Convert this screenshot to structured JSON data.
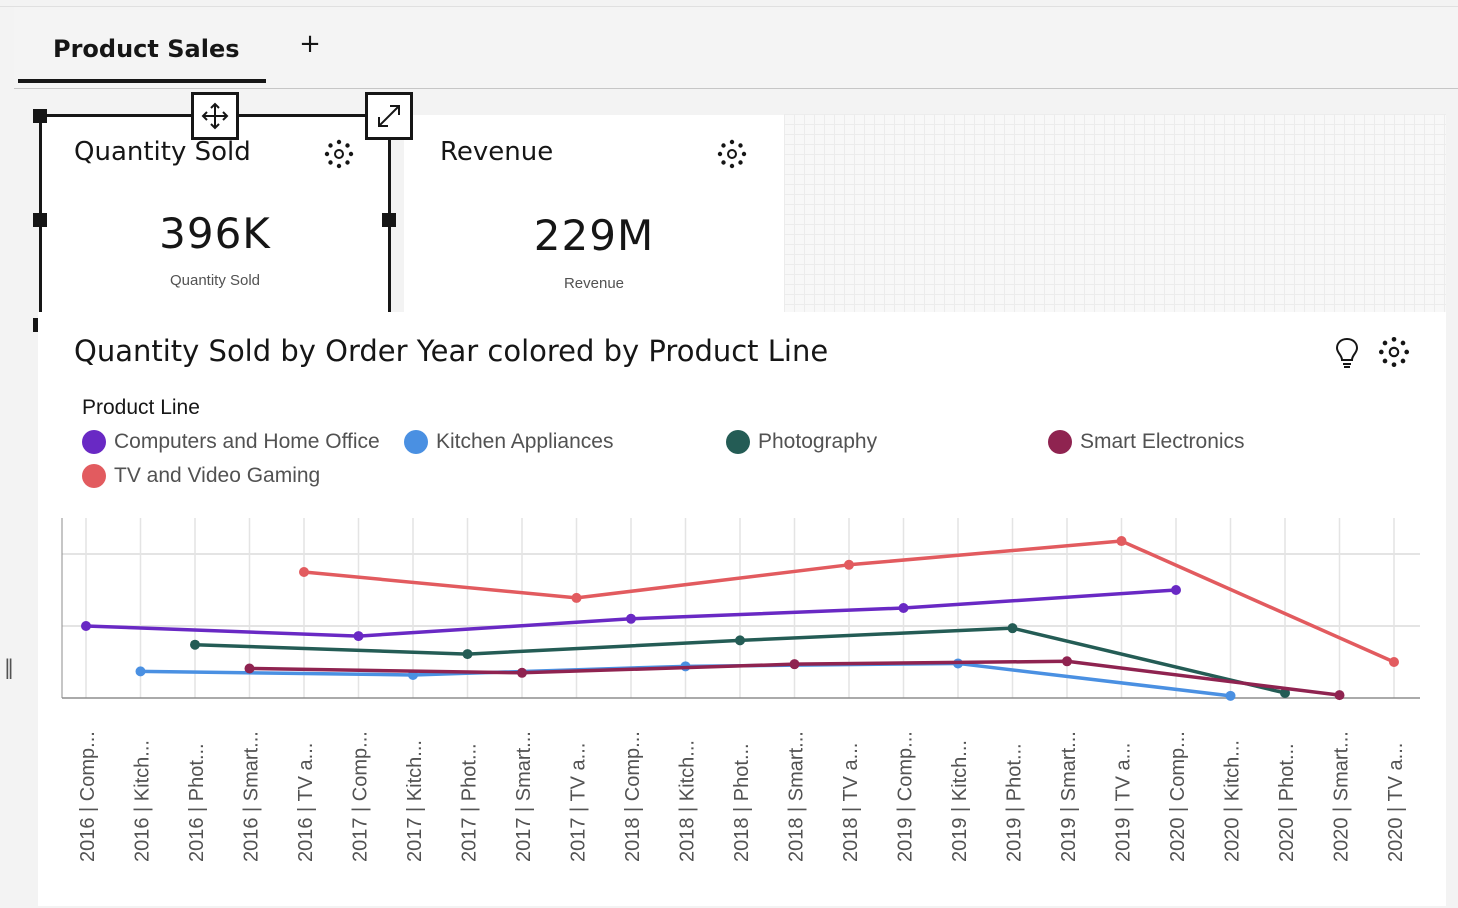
{
  "tabs": [
    {
      "label": "Product Sales"
    }
  ],
  "add_tab_symbol": "+",
  "kpis": [
    {
      "title": "Quantity Sold",
      "value": "396K",
      "subtitle": "Quantity Sold"
    },
    {
      "title": "Revenue",
      "value": "229M",
      "subtitle": "Revenue"
    }
  ],
  "chart": {
    "title": "Quantity Sold by Order Year colored by Product Line",
    "legend_title": "Product Line"
  },
  "colors": {
    "Computers and Home Office": "#6929c4",
    "Kitchen Appliances": "#4a90e2",
    "Photography": "#245c55",
    "Smart Electronics": "#8f2350",
    "TV and Video Gaming": "#e25b5f"
  },
  "chart_data": {
    "type": "line",
    "legend_placement": "top",
    "grid": true,
    "categories": [
      "2016 | Comp...",
      "2016 | Kitch...",
      "2016 | Phot...",
      "2016 | Smart...",
      "2016 | TV a...",
      "2017 | Comp...",
      "2017 | Kitch...",
      "2017 | Phot...",
      "2017 | Smart...",
      "2017 | TV a...",
      "2018 | Comp...",
      "2018 | Kitch...",
      "2018 | Phot...",
      "2018 | Smart...",
      "2018 | TV a...",
      "2019 | Comp...",
      "2019 | Kitch...",
      "2019 | Phot...",
      "2019 | Smart...",
      "2019 | TV a...",
      "2020 | Comp...",
      "2020 | Kitch...",
      "2020 | Phot...",
      "2020 | Smart...",
      "2020 | TV a..."
    ],
    "ylim": [
      0,
      25
    ],
    "series": [
      {
        "name": "Computers and Home Office",
        "points": [
          [
            0,
            10
          ],
          [
            5,
            8.6
          ],
          [
            10,
            11
          ],
          [
            15,
            12.5
          ],
          [
            20,
            15
          ]
        ]
      },
      {
        "name": "Kitchen Appliances",
        "points": [
          [
            1,
            3.7
          ],
          [
            6,
            3.2
          ],
          [
            11,
            4.4
          ],
          [
            16,
            4.8
          ],
          [
            21,
            0.3
          ]
        ]
      },
      {
        "name": "Photography",
        "points": [
          [
            2,
            7.4
          ],
          [
            7,
            6.1
          ],
          [
            12,
            8
          ],
          [
            17,
            9.7
          ],
          [
            22,
            0.7
          ]
        ]
      },
      {
        "name": "Smart Electronics",
        "points": [
          [
            3,
            4.1
          ],
          [
            8,
            3.5
          ],
          [
            13,
            4.7
          ],
          [
            18,
            5.1
          ],
          [
            23,
            0.4
          ]
        ]
      },
      {
        "name": "TV and Video Gaming",
        "points": [
          [
            4,
            17.5
          ],
          [
            9,
            13.9
          ],
          [
            14,
            18.5
          ],
          [
            19,
            21.8
          ],
          [
            24,
            5
          ]
        ]
      }
    ]
  }
}
